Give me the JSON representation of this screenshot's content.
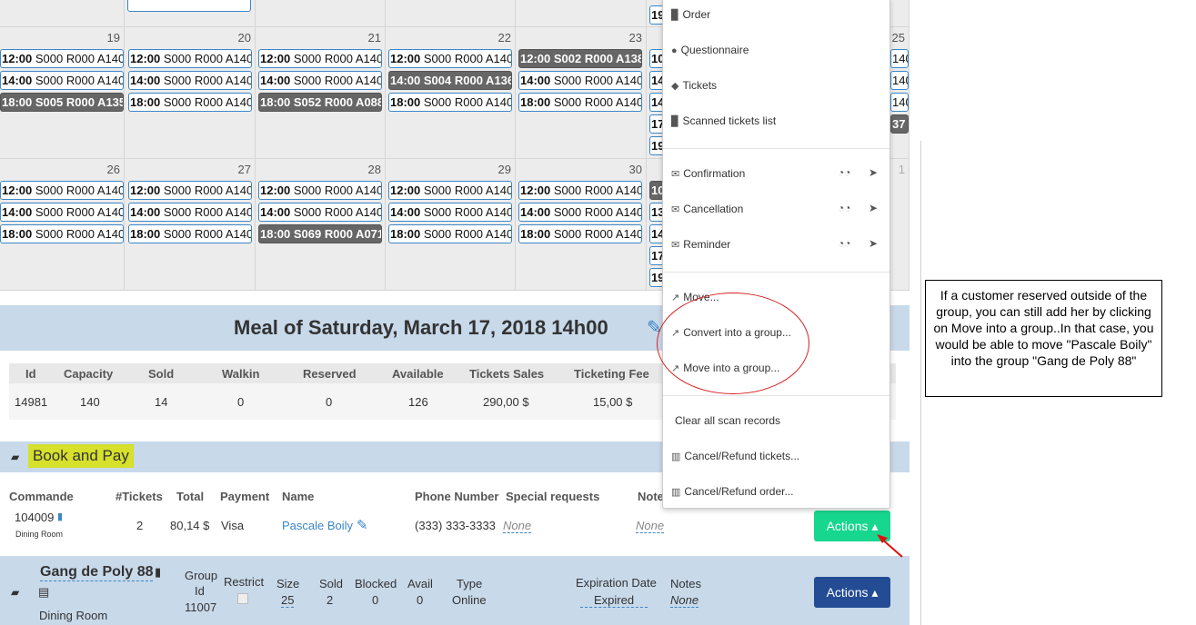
{
  "calendar": {
    "week1": {
      "days": [
        "19",
        "20",
        "21",
        "22",
        "23",
        "25"
      ],
      "events": [
        [
          "12:00",
          "S000 R000 A140"
        ],
        [
          "14:00",
          "S000 R000 A140"
        ],
        [
          "18:00",
          "S005 R000 A135"
        ],
        [
          "12:00",
          "S000 R000 A140"
        ],
        [
          "14:00",
          "S000 R000 A140"
        ],
        [
          "18:00",
          "S000 R000 A140"
        ],
        [
          "12:00",
          "S000 R000 A140"
        ],
        [
          "14:00",
          "S000 R000 A140"
        ],
        [
          "18:00",
          "S052 R000 A088"
        ],
        [
          "12:00",
          "S000 R000 A140"
        ],
        [
          "14:00",
          "S004 R000 A136"
        ],
        [
          "18:00",
          "S000 R000 A140"
        ],
        [
          "12:00",
          "S002 R000 A138"
        ],
        [
          "14:00",
          "S000 R000 A140"
        ],
        [
          "18:00",
          "S000 R000 A140"
        ]
      ],
      "partial": [
        "19",
        "10",
        "14",
        "14",
        "17",
        "19"
      ],
      "right_partial": [
        "140",
        "140",
        "140",
        "37"
      ]
    },
    "week2": {
      "days": [
        "26",
        "27",
        "28",
        "29",
        "30",
        "1"
      ],
      "events": [
        [
          "12:00",
          "S000 R000 A140"
        ],
        [
          "14:00",
          "S000 R000 A140"
        ],
        [
          "18:00",
          "S000 R000 A140"
        ],
        [
          "12:00",
          "S000 R000 A140"
        ],
        [
          "14:00",
          "S000 R000 A140"
        ],
        [
          "18:00",
          "S000 R000 A140"
        ],
        [
          "12:00",
          "S000 R000 A140"
        ],
        [
          "14:00",
          "S000 R000 A140"
        ],
        [
          "18:00",
          "S069 R000 A071"
        ],
        [
          "12:00",
          "S000 R000 A140"
        ],
        [
          "14:00",
          "S000 R000 A140"
        ],
        [
          "18:00",
          "S000 R000 A140"
        ],
        [
          "12:00",
          "S000 R000 A140"
        ],
        [
          "14:00",
          "S000 R000 A140"
        ],
        [
          "18:00",
          "S000 R000 A140"
        ]
      ],
      "partial": [
        "10",
        "13",
        "14",
        "17",
        "19"
      ]
    }
  },
  "meal": {
    "title": "Meal of Saturday, March 17, 2018 14h00",
    "headers": [
      "Id",
      "Capacity",
      "Sold",
      "Walkin",
      "Reserved",
      "Available",
      "Tickets Sales",
      "Ticketing Fee"
    ],
    "values": [
      "14981",
      "140",
      "14",
      "0",
      "0",
      "126",
      "290,00 $",
      "15,00 $"
    ]
  },
  "book": {
    "title": "Book and Pay",
    "headers": [
      "Commande",
      "#Tickets",
      "Total",
      "Payment",
      "Name",
      "Phone Number",
      "Special requests",
      "Note"
    ],
    "order": {
      "id": "104009",
      "room": "Dining Room",
      "tickets": "2",
      "total": "80,14 $",
      "payment": "Visa",
      "name": "Pascale Boily",
      "phone": "(333) 333-3333",
      "special": "None",
      "note": "None",
      "actions": "Actions ▴"
    }
  },
  "group": {
    "name": "Gang de Poly 88",
    "room": "Dining Room",
    "labels": {
      "group_id_1": "Group",
      "group_id_2": "Id",
      "restrict": "Restrict",
      "size": "Size",
      "sold": "Sold",
      "blocked": "Blocked",
      "avail": "Avail",
      "type": "Type",
      "expiration": "Expiration Date",
      "notes": "Notes"
    },
    "values": {
      "group_id": "11007",
      "size": "25",
      "sold": "2",
      "blocked": "0",
      "avail": "0",
      "type": "Online",
      "expiration": "Expired",
      "notes": "None"
    },
    "actions": "Actions ▴"
  },
  "menu": {
    "items": [
      "Order",
      "Questionnaire",
      "Tickets",
      "Scanned tickets list",
      "Confirmation",
      "Cancellation",
      "Reminder",
      "Move...",
      "Convert into a group...",
      "Move into a group...",
      "Clear all scan records",
      "Cancel/Refund tickets...",
      "Cancel/Refund order..."
    ]
  },
  "note": "If a customer reserved outside of the group, you can still add her by clicking on Move into a group..In that case, you would be able to move \"Pascale Boily\" into the group \"Gang de Poly 88\"",
  "colors": {
    "accent_green": "#17d68e",
    "accent_blue": "#234c95",
    "header_bg": "#c8d9ea",
    "highlight": "#d7e02a"
  }
}
